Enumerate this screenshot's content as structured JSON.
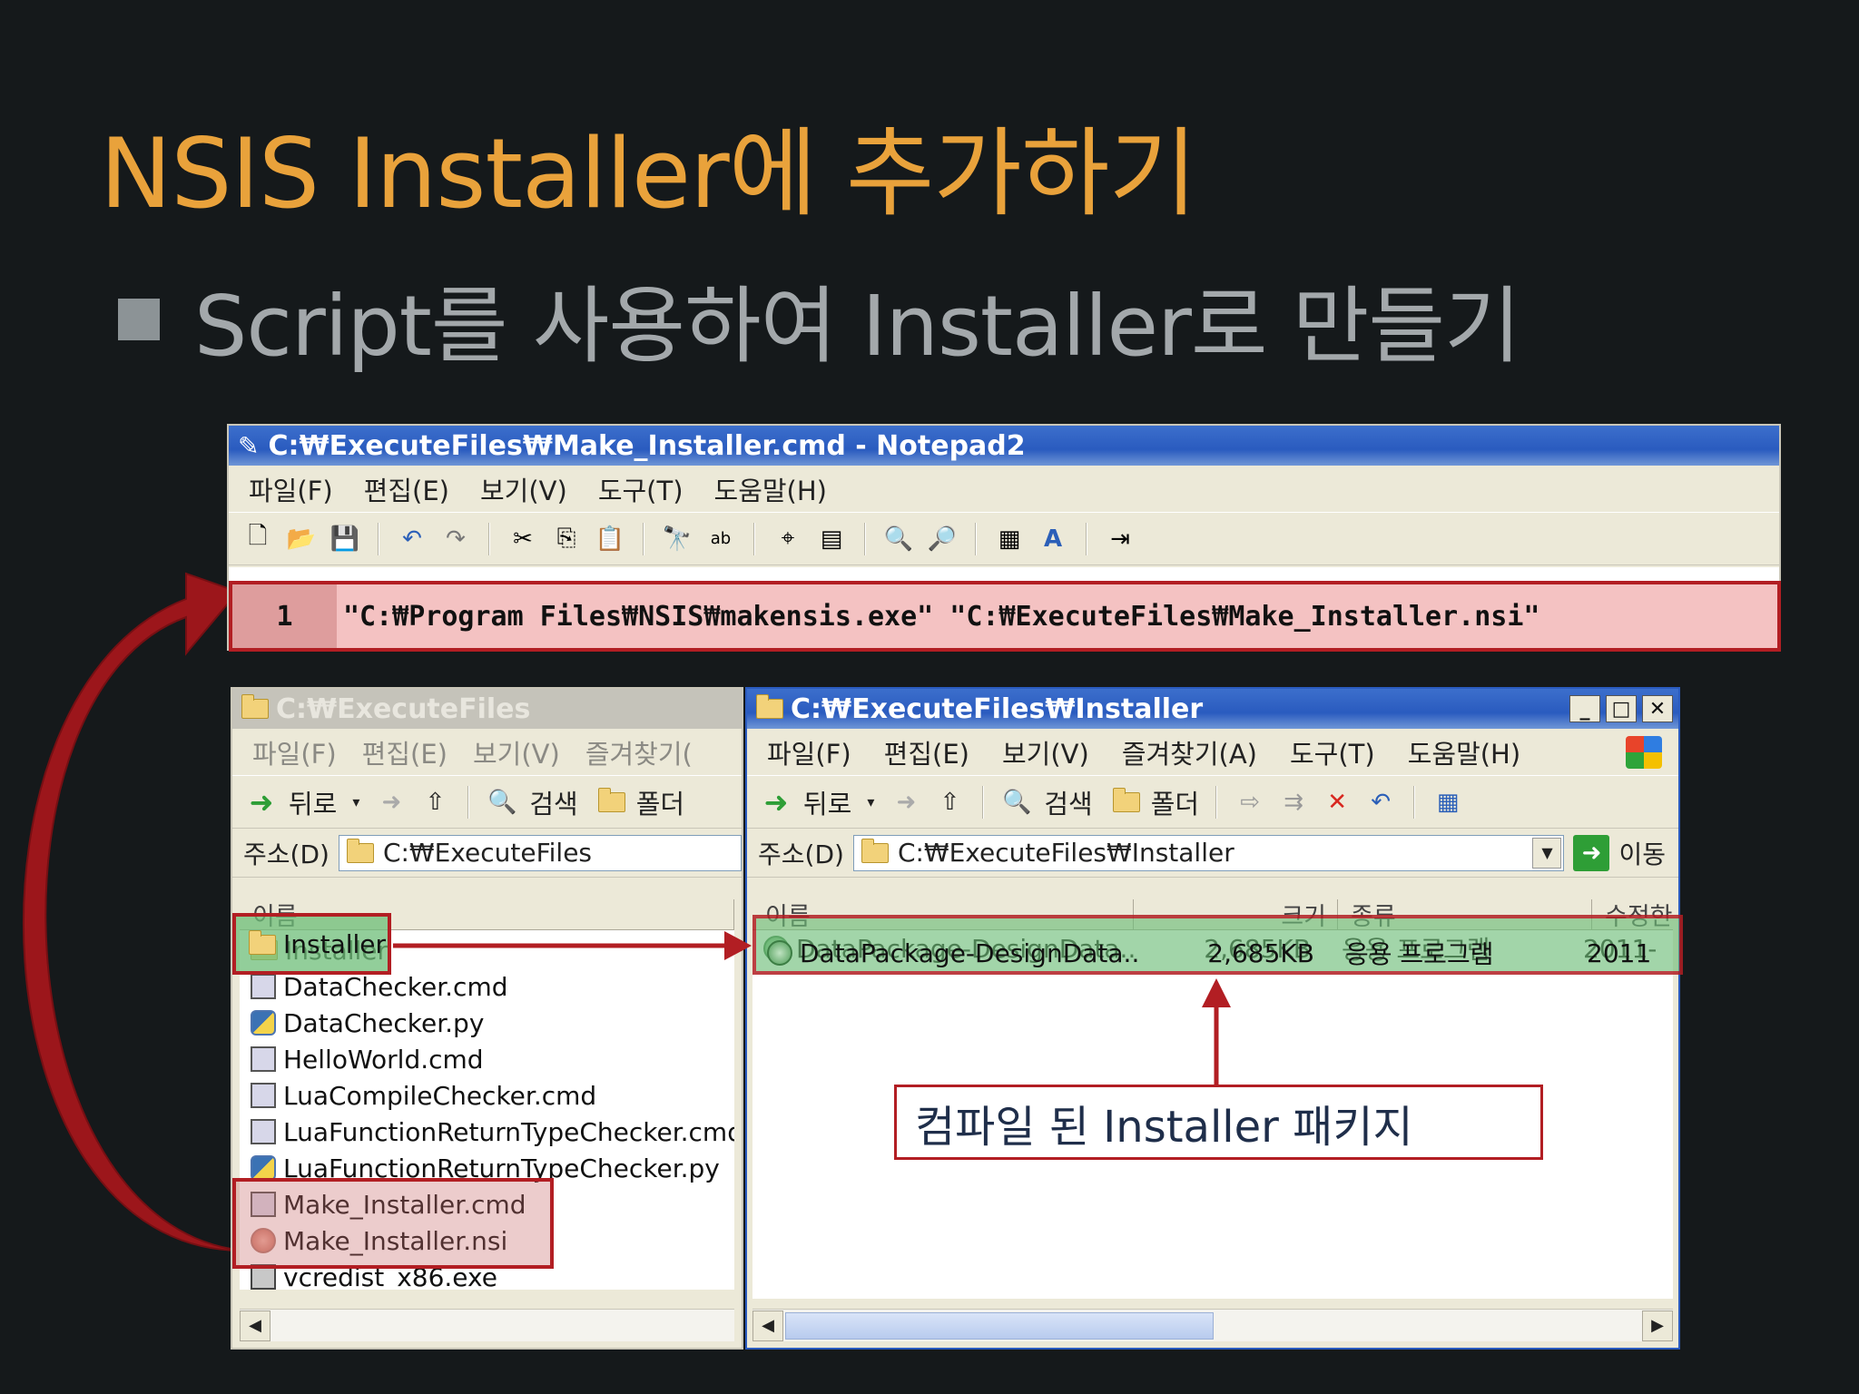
{
  "slide": {
    "title": "NSIS Installer에 추가하기",
    "bullet": "Script를 사용하여 Installer로 만들기"
  },
  "notepad": {
    "title": "C:₩ExecuteFiles₩Make_Installer.cmd - Notepad2",
    "menu": [
      "파일(F)",
      "편집(E)",
      "보기(V)",
      "도구(T)",
      "도움말(H)"
    ],
    "line_number": "1",
    "code_line": "\"C:₩Program Files₩NSIS₩makensis.exe\" \"C:₩ExecuteFiles₩Make_Installer.nsi\""
  },
  "left_explorer": {
    "title": "C:₩ExecuteFiles",
    "menu": [
      "파일(F)",
      "편집(E)",
      "보기(V)",
      "즐겨찾기("
    ],
    "toolbar": {
      "back": "뒤로",
      "search": "검색",
      "folders": "폴더"
    },
    "address_label": "주소(D)",
    "address_value": "C:₩ExecuteFiles",
    "column_name": "이름",
    "files": [
      {
        "name": "Installer",
        "type": "folder"
      },
      {
        "name": "DataChecker.cmd",
        "type": "cmd"
      },
      {
        "name": "DataChecker.py",
        "type": "py"
      },
      {
        "name": "HelloWorld.cmd",
        "type": "cmd"
      },
      {
        "name": "LuaCompileChecker.cmd",
        "type": "cmd"
      },
      {
        "name": "LuaFunctionReturnTypeChecker.cmd",
        "type": "cmd"
      },
      {
        "name": "LuaFunctionReturnTypeChecker.py",
        "type": "py"
      },
      {
        "name": "Make_Installer.cmd",
        "type": "cmd"
      },
      {
        "name": "Make_Installer.nsi",
        "type": "nsi"
      },
      {
        "name": "vcredist_x86.exe",
        "type": "exe"
      }
    ]
  },
  "right_explorer": {
    "title": "C:₩ExecuteFiles₩Installer",
    "menu": [
      "파일(F)",
      "편집(E)",
      "보기(V)",
      "즐겨찾기(A)",
      "도구(T)",
      "도움말(H)"
    ],
    "toolbar": {
      "back": "뒤로",
      "search": "검색",
      "folders": "폴더"
    },
    "address_label": "주소(D)",
    "address_value": "C:₩ExecuteFiles₩Installer",
    "go_label": "이동",
    "columns": [
      "이름",
      "크기",
      "종류",
      "수정한"
    ],
    "row": {
      "name": "DataPackage-DesignData...",
      "size": "2,685KB",
      "type": "응용 프로그램",
      "modified": "2011-"
    }
  },
  "callout": "컴파일 된 Installer 패키지",
  "colors": {
    "title": "#e9a23b",
    "highlight_red": "#b21e23",
    "xp_blue": "#2a5bbf"
  }
}
